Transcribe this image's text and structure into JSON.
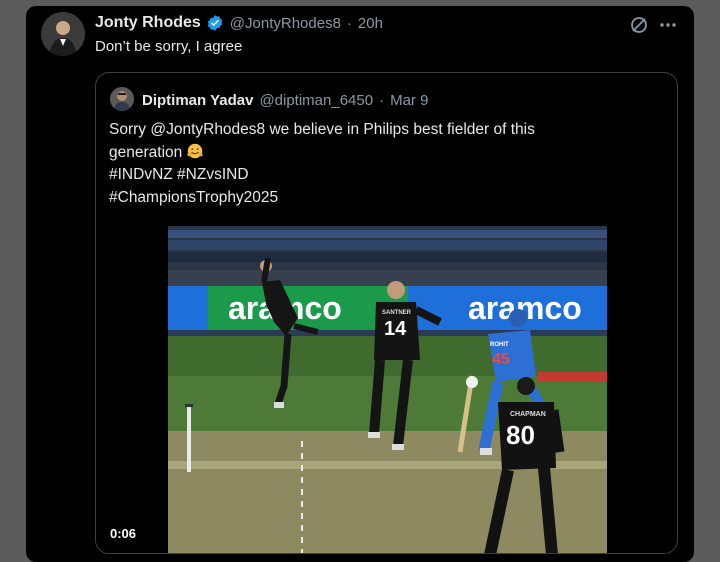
{
  "tweet": {
    "author_name": "Jonty Rhodes",
    "author_handle": "@JontyRhodes8",
    "separator": "·",
    "time": "20h",
    "text": "Don’t be sorry, I agree"
  },
  "quoted": {
    "author_name": "Diptiman Yadav",
    "author_handle": "@diptiman_6450",
    "separator": "·",
    "date": "Mar 9",
    "lines": [
      "Sorry @JontyRhodes8 we believe in Philips best fielder of this",
      "generation",
      "#INDvNZ #NZvsIND",
      "#ChampionsTrophy2025"
    ],
    "media": {
      "video_time": "0:06",
      "board_text": "aramco",
      "jersey_1_name": "SANTNER",
      "jersey_1_number": "14",
      "jersey_2_name": "ROHIT",
      "jersey_2_number": "45",
      "jersey_3_name": "CHAPMAN",
      "jersey_3_number": "80"
    }
  },
  "colors": {
    "accent": "#1d9bf0",
    "muted_text": "#8b98a5",
    "border": "#3e4144"
  },
  "icons": [
    "grok-icon",
    "more-icon",
    "verified-badge-icon",
    "hugging-face-emoji"
  ]
}
